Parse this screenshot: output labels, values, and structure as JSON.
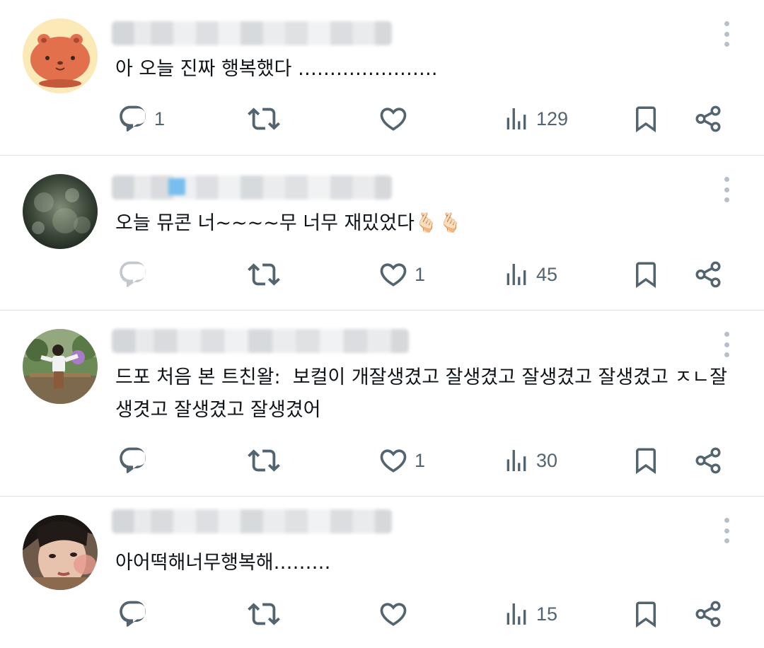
{
  "posts": [
    {
      "text": "아 오늘 진짜 행복했다 ………………….",
      "avatar": "capybara-cartoon",
      "replies": "1",
      "retweets": "",
      "likes": "",
      "views": "129"
    },
    {
      "text": "오늘 뮤콘 너~~~~무 너무 재밌었다🫰🏻🫰🏻",
      "avatar": "night-bokeh-photo",
      "replies": "",
      "retweets": "",
      "likes": "1",
      "views": "45"
    },
    {
      "text": "드포 처음 본 트친왈:  보컬이 개잘생겼고 잘생겼고 잘생겼고 잘생겼고 ㅈㄴ잘생겻고 잘생겼고 잘생겼어",
      "avatar": "person-garden-photo",
      "replies": "",
      "retweets": "",
      "likes": "1",
      "views": "30"
    },
    {
      "text": "아어떡해너무행복해………",
      "avatar": "face-closeup-photo",
      "replies": "",
      "retweets": "",
      "likes": "",
      "views": "15"
    }
  ],
  "colors": {
    "icon": "#536471",
    "text": "#0f1419",
    "divider": "#dfe3e6",
    "more_dots": "#b8bfc6"
  },
  "icons": [
    "reply-icon",
    "retweet-icon",
    "like-icon",
    "views-icon",
    "bookmark-icon",
    "share-icon",
    "more-icon"
  ]
}
